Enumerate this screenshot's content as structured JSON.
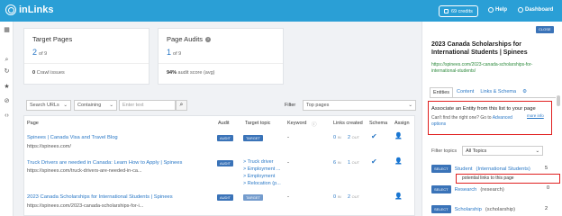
{
  "header": {
    "logo": "inLinks",
    "credits": "69 credits",
    "help": "Help",
    "dashboard": "Dashboard"
  },
  "sidebar": {
    "icons": [
      "apps-icon",
      "search-icon",
      "refresh-icon",
      "star-icon",
      "link-icon",
      "code-icon"
    ]
  },
  "target_pages": {
    "title": "Target Pages",
    "value": "2",
    "of": "of 9",
    "crawl_count": "0",
    "crawl_label": "Crawl issues"
  },
  "page_audits": {
    "title": "Page Audits",
    "value": "1",
    "of": "of 9",
    "score": "94%",
    "score_label": "audit score (avg)"
  },
  "filters": {
    "search_field": "Search URLs",
    "match": "Containing",
    "placeholder": "Enter text",
    "filter_label": "Filter",
    "filter_value": "Top pages"
  },
  "table": {
    "headers": [
      "Page",
      "Audit",
      "Target topic",
      "Keyword",
      "Links created",
      "Schema",
      "Assign"
    ],
    "rows": [
      {
        "title": "Spinees | Canada Visa and Travel Blog",
        "url": "https://spinees.com/",
        "audit": "AUDIT",
        "target": "TARGET",
        "topics": [],
        "keyword": "-",
        "links_in": "0",
        "links_out": "2",
        "schema": true
      },
      {
        "title": "Truck Drivers are needed in Canada: Learn How to Apply | Spinees",
        "url": "https://spinees.com/truck-drivers-are-needed-in-ca...",
        "audit": "AUDIT",
        "target": "",
        "topics": [
          "> Truck driver",
          "> Employment ...",
          "> Employment",
          "> Relocation (p..."
        ],
        "keyword": "-",
        "links_in": "6",
        "links_out": "1",
        "schema": true
      },
      {
        "title": "2023 Canada Scholarships for International Students | Spinees",
        "url": "https://spinees.com/2023-canada-scholarships-for-i...",
        "audit": "AUDIT",
        "target": "TARGET",
        "topics": [],
        "keyword": "-",
        "links_in": "0",
        "links_out": "2",
        "schema": false
      }
    ],
    "in_label": "IN",
    "out_label": "OUT"
  },
  "panel": {
    "close": "CLOSE",
    "title": "2023 Canada Scholarships for International Students | Spinees",
    "url": "https://spinees.com/2023-canada-scholarships-for-international-students/",
    "tabs": [
      "Entities",
      "Content",
      "Links & Schema"
    ],
    "assoc_title": "Associate an Entity from this list to your page",
    "assoc_sub": "Can't find the right one? Go to",
    "assoc_link": "Advanced options",
    "more_info": "more info",
    "filter_label": "Filter topics",
    "filter_value": "All Topics",
    "select_label": "SELECT",
    "entities": [
      {
        "name": "Student",
        "sub": "(International Students)",
        "count": "5"
      },
      {
        "name": "Research",
        "sub": "(research)",
        "count": "0"
      },
      {
        "name": "Scholarship",
        "sub": "(scholarship)",
        "count": "2"
      }
    ],
    "tooltip": "potential links to this page"
  }
}
